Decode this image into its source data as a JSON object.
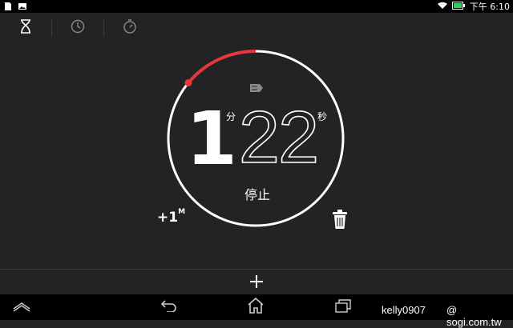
{
  "status_bar": {
    "time": "下午 6:10",
    "icons": [
      "sd-card-icon",
      "image-icon",
      "wifi-icon",
      "battery-icon"
    ],
    "battery_color": "#2fd05a"
  },
  "tabs": [
    {
      "name": "timer",
      "icon": "hourglass-icon",
      "active": true
    },
    {
      "name": "clock",
      "icon": "clock-icon",
      "active": false
    },
    {
      "name": "stopwatch",
      "icon": "stopwatch-icon",
      "active": false
    }
  ],
  "timer": {
    "minutes": "1",
    "minutes_unit": "分",
    "seconds": "22",
    "seconds_unit": "秒",
    "stop_label": "停止",
    "add_minute_label": "+1",
    "add_minute_suffix": "M",
    "elapsed_fraction": 0.14,
    "progress_color": "#e8373c",
    "ring_color": "#ffffff"
  },
  "watermark": {
    "user": "kelly0907",
    "site": "@ sogi.com.tw"
  }
}
